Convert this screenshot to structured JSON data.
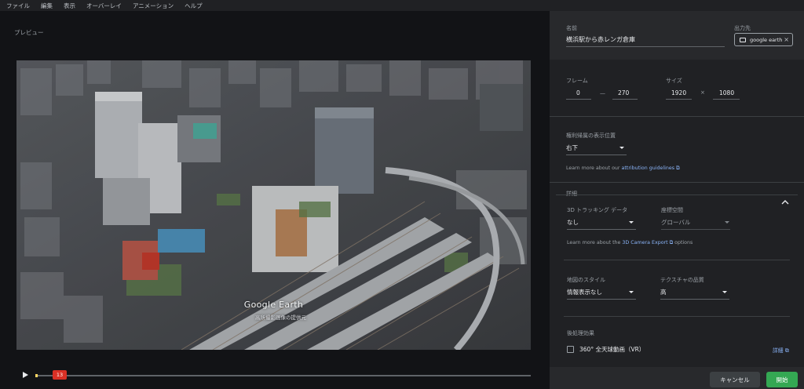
{
  "menu": [
    "ファイル",
    "編集",
    "表示",
    "オーバーレイ",
    "アニメーション",
    "ヘルプ"
  ],
  "preview": {
    "label": "プレビュー",
    "logo": "Google Earth",
    "sub": "高所撮影画像の提供元",
    "playhead": "13"
  },
  "panel": {
    "name_label": "名前",
    "name_value": "横浜駅から赤レンガ倉庫",
    "output_label": "出力先",
    "output_value": "google earth",
    "frame_label": "フレーム",
    "frame_start": "0",
    "frame_sep": "—",
    "frame_end": "270",
    "size_label": "サイズ",
    "size_w": "1920",
    "size_sep": "×",
    "size_h": "1080",
    "attrib_label": "権利帰属の表示位置",
    "attrib_value": "右下",
    "attrib_link_pre": "Learn more about our ",
    "attrib_link": "attribution guidelines",
    "details_label": "詳細",
    "tracking_label": "3D トラッキング データ",
    "tracking_value": "なし",
    "coord_label": "座標空間",
    "coord_value": "グローバル",
    "camera_link_pre": "Learn more about the ",
    "camera_link": "3D Camera Export",
    "camera_link_post": " options",
    "mapstyle_label": "地図のスタイル",
    "mapstyle_value": "情報表示なし",
    "texture_label": "テクスチャの品質",
    "texture_value": "高",
    "post_label": "後処理効果",
    "vr_label": "360° 全天球動画（VR）",
    "vr_link": "詳細",
    "cancel": "キャンセル",
    "start": "開始"
  }
}
